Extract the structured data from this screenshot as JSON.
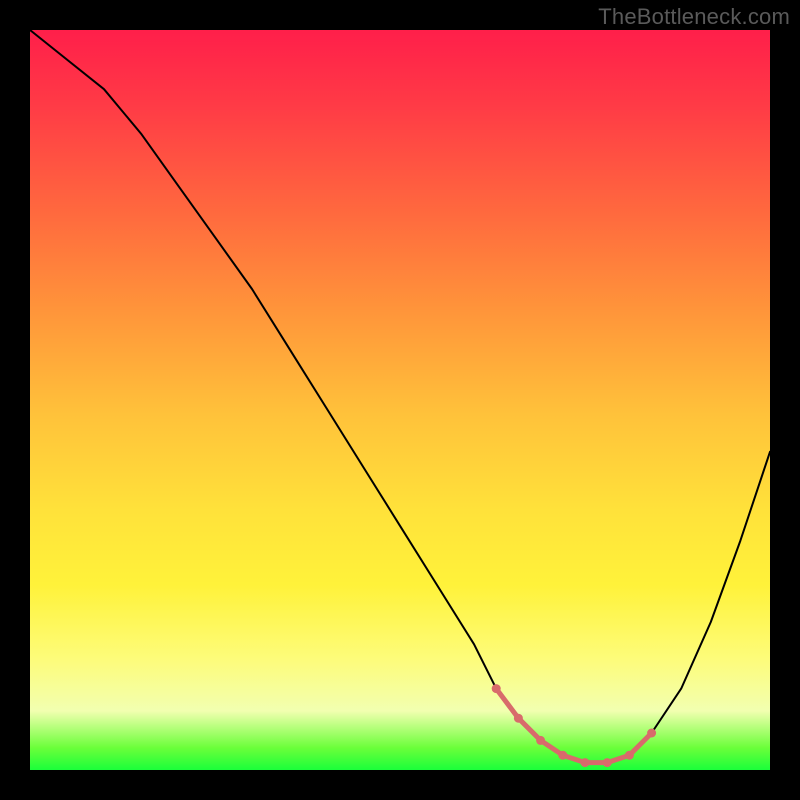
{
  "watermark": "TheBottleneck.com",
  "colors": {
    "background": "#000000",
    "watermark_text": "#5a5a5a",
    "curve": "#000000",
    "marker": "#d86b6b",
    "gradient_stops": [
      "#ff1f4a",
      "#ff3a46",
      "#ff6a3e",
      "#ff953a",
      "#ffc23a",
      "#ffe23a",
      "#fff23a",
      "#fdfc7a",
      "#f2ffb0",
      "#6bff3a",
      "#1aff3a"
    ]
  },
  "chart_data": {
    "type": "line",
    "title": "",
    "xlabel": "",
    "ylabel": "",
    "xlim": [
      0,
      100
    ],
    "ylim": [
      0,
      100
    ],
    "series": [
      {
        "name": "bottleneck-curve",
        "x": [
          0,
          5,
          10,
          15,
          20,
          25,
          30,
          35,
          40,
          45,
          50,
          55,
          60,
          63,
          66,
          69,
          72,
          75,
          78,
          81,
          84,
          88,
          92,
          96,
          100
        ],
        "y": [
          100,
          96,
          92,
          86,
          79,
          72,
          65,
          57,
          49,
          41,
          33,
          25,
          17,
          11,
          7,
          4,
          2,
          1,
          1,
          2,
          5,
          11,
          20,
          31,
          43
        ]
      },
      {
        "name": "optimal-range-marker",
        "x": [
          63,
          66,
          69,
          72,
          75,
          78,
          81,
          84
        ],
        "y": [
          11,
          7,
          4,
          2,
          1,
          1,
          2,
          5
        ]
      }
    ],
    "annotations": []
  }
}
